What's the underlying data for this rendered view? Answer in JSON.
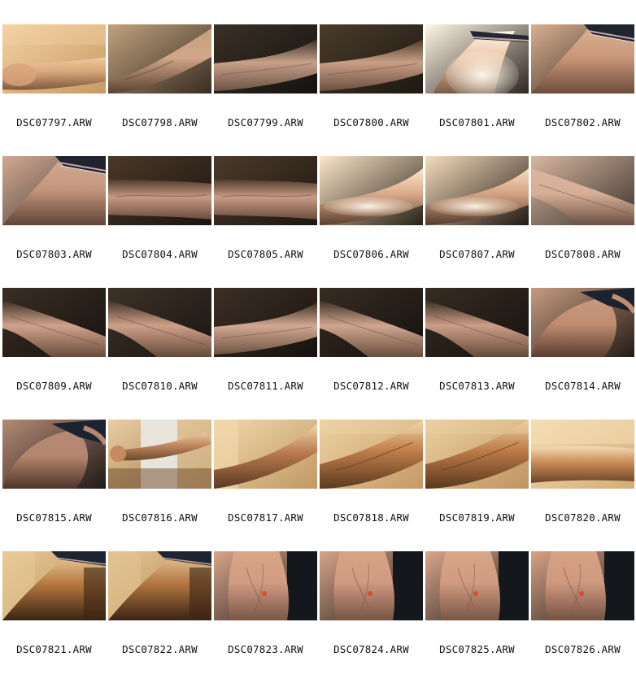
{
  "thumbnails": [
    {
      "filename": "DSC07797.ARW",
      "bg": "#c89a62",
      "light": "#f3d2a4",
      "arm": "#d9a47c",
      "shade": "#6e4a2e",
      "style": "blur"
    },
    {
      "filename": "DSC07798.ARW",
      "bg": "#3a2c22",
      "light": "#c0a27e",
      "arm": "#d2a688",
      "shade": "#5a4030",
      "style": "diag-up"
    },
    {
      "filename": "DSC07799.ARW",
      "bg": "#15120f",
      "light": "#3a3026",
      "arm": "#c6a08a",
      "shade": "#6d5244",
      "style": "horiz-rise"
    },
    {
      "filename": "DSC07800.ARW",
      "bg": "#1d1812",
      "light": "#4a3b2a",
      "arm": "#c89f86",
      "shade": "#6a4f40",
      "style": "horiz-rise"
    },
    {
      "filename": "DSC07801.ARW",
      "bg": "#2e2620",
      "light": "#fff6e6",
      "arm": "#e8c2a2",
      "shade": "#7a5a44",
      "style": "upper-bright"
    },
    {
      "filename": "DSC07802.ARW",
      "bg": "#2a221c",
      "light": "#d9b090",
      "arm": "#c9967a",
      "shade": "#6d4c3a",
      "style": "upper"
    },
    {
      "filename": "DSC07803.ARW",
      "bg": "#3a3532",
      "light": "#d2a890",
      "arm": "#c5957d",
      "shade": "#5e4436",
      "style": "upper"
    },
    {
      "filename": "DSC07804.ARW",
      "bg": "#1c1510",
      "light": "#4a3828",
      "arm": "#c79a84",
      "shade": "#6a4c3c",
      "style": "horiz"
    },
    {
      "filename": "DSC07805.ARW",
      "bg": "#1e1711",
      "light": "#4c3a2a",
      "arm": "#c99c86",
      "shade": "#6a4c3c",
      "style": "horiz"
    },
    {
      "filename": "DSC07806.ARW",
      "bg": "#2a2218",
      "light": "#fbe6c8",
      "arm": "#d8aa8a",
      "shade": "#5a3e2c",
      "style": "bright-band"
    },
    {
      "filename": "DSC07807.ARW",
      "bg": "#221a14",
      "light": "#f6dcbc",
      "arm": "#d3a283",
      "shade": "#553a2a",
      "style": "bright-band"
    },
    {
      "filename": "DSC07808.ARW",
      "bg": "#3a332d",
      "light": "#d8b6a0",
      "arm": "#d6ae96",
      "shade": "#6a5044",
      "style": "diag-down"
    },
    {
      "filename": "DSC07809.ARW",
      "bg": "#18130f",
      "light": "#3a2e24",
      "arm": "#d0a38c",
      "shade": "#6a4c3c",
      "style": "diag-down"
    },
    {
      "filename": "DSC07810.ARW",
      "bg": "#1a1511",
      "light": "#3e3227",
      "arm": "#cea08a",
      "shade": "#664a3a",
      "style": "diag-down"
    },
    {
      "filename": "DSC07811.ARW",
      "bg": "#17120e",
      "light": "#3c2f25",
      "arm": "#d2a892",
      "shade": "#6e5242",
      "style": "horiz-rise"
    },
    {
      "filename": "DSC07812.ARW",
      "bg": "#15110e",
      "light": "#382c22",
      "arm": "#d0a690",
      "shade": "#6a4e3e",
      "style": "diag-down"
    },
    {
      "filename": "DSC07813.ARW",
      "bg": "#16120e",
      "light": "#382c22",
      "arm": "#cc9e88",
      "shade": "#664a3a",
      "style": "diag-down"
    },
    {
      "filename": "DSC07814.ARW",
      "bg": "#241c16",
      "light": "#c79a80",
      "arm": "#c08c72",
      "shade": "#5a3c2e",
      "style": "bicep"
    },
    {
      "filename": "DSC07815.ARW",
      "bg": "#1f1a17",
      "light": "#b48a76",
      "arm": "#b5866f",
      "shade": "#4e352a",
      "style": "bicep"
    },
    {
      "filename": "DSC07816.ARW",
      "bg": "#a3794a",
      "light": "#e9cfa4",
      "arm": "#c58a62",
      "shade": "#6e4a2e",
      "style": "room"
    },
    {
      "filename": "DSC07817.ARW",
      "bg": "#c19964",
      "light": "#f1d8ac",
      "arm": "#b97a4e",
      "shade": "#5a3a22",
      "style": "warm-diag"
    },
    {
      "filename": "DSC07818.ARW",
      "bg": "#c59a66",
      "light": "#eed2a4",
      "arm": "#c07e4a",
      "shade": "#5c3a20",
      "style": "warm-big"
    },
    {
      "filename": "DSC07819.ARW",
      "bg": "#bf9462",
      "light": "#ecd0a0",
      "arm": "#bd7b48",
      "shade": "#5a381e",
      "style": "warm-big"
    },
    {
      "filename": "DSC07820.ARW",
      "bg": "#d3ad78",
      "light": "#f4dcb2",
      "arm": "#c88a56",
      "shade": "#6a4426",
      "style": "warm-horiz"
    },
    {
      "filename": "DSC07821.ARW",
      "bg": "#b98e58",
      "light": "#e8ca98",
      "arm": "#b3763f",
      "shade": "#3a2414",
      "style": "warm-up"
    },
    {
      "filename": "DSC07822.ARW",
      "bg": "#b68a55",
      "light": "#e4c494",
      "arm": "#b0743e",
      "shade": "#3a2414",
      "style": "warm-up"
    },
    {
      "filename": "DSC07823.ARW",
      "bg": "#1c1a18",
      "light": "#d9a68a",
      "arm": "#d19c82",
      "shade": "#7a5646",
      "style": "hand"
    },
    {
      "filename": "DSC07824.ARW",
      "bg": "#1c1a18",
      "light": "#d8a488",
      "arm": "#cf9a80",
      "shade": "#785444",
      "style": "hand"
    },
    {
      "filename": "DSC07825.ARW",
      "bg": "#1c1a18",
      "light": "#d9a68a",
      "arm": "#d09b81",
      "shade": "#7a5646",
      "style": "hand"
    },
    {
      "filename": "DSC07826.ARW",
      "bg": "#1d1b19",
      "light": "#d7a286",
      "arm": "#ce997f",
      "shade": "#765242",
      "style": "hand"
    }
  ]
}
